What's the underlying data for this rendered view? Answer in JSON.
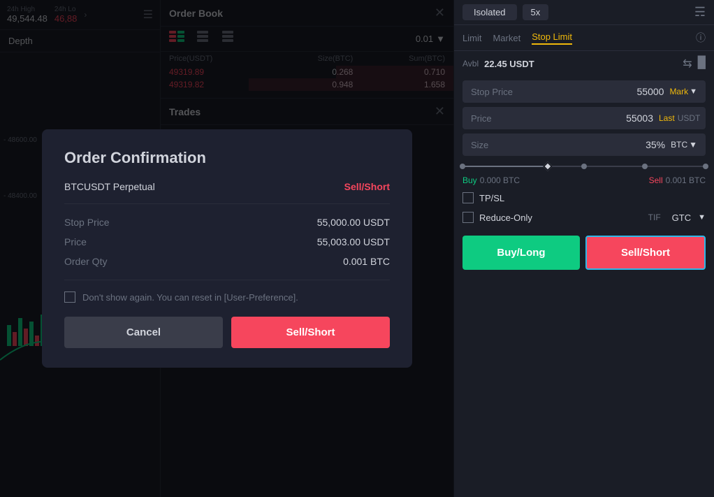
{
  "left_panel": {
    "stat_24h_high_label": "24h High",
    "stat_24h_low_label": "24h Lo",
    "stat_24h_high_value": "49,544.48",
    "stat_24h_low_value": "46,88",
    "depth_tab": "Depth",
    "price_label_1": "- 48600.00",
    "price_label_2": "- 48400.00"
  },
  "order_book": {
    "title": "Order Book",
    "decimal_value": "0.01",
    "col_price": "Price(USDT)",
    "col_size": "Size(BTC)",
    "col_sum": "Sum(BTC)",
    "sell_rows": [
      {
        "price": "49319.89",
        "size": "0.268",
        "sum": "0.710",
        "bar_pct": "40"
      },
      {
        "price": "49319.82",
        "size": "0.948",
        "sum": "1.658",
        "bar_pct": "70"
      }
    ],
    "trades_title": "Trades"
  },
  "right_panel": {
    "isolated_label": "Isolated",
    "leverage_label": "5x",
    "order_types": {
      "limit": "Limit",
      "market": "Market",
      "stop_limit": "Stop Limit",
      "active": "Stop Limit"
    },
    "avbl_label": "Avbl",
    "avbl_value": "22.45 USDT",
    "stop_price_label": "Stop Price",
    "stop_price_value": "55000",
    "stop_price_tag": "Mark",
    "price_label": "Price",
    "price_value": "55003",
    "price_tag": "Last",
    "price_unit": "USDT",
    "size_label": "Size",
    "size_value": "35%",
    "size_unit": "BTC",
    "buy_label": "Buy",
    "buy_amount": "0.000 BTC",
    "sell_label": "Sell",
    "sell_amount": "0.001 BTC",
    "tp_sl_label": "TP/SL",
    "reduce_only_label": "Reduce-Only",
    "tif_label": "TIF",
    "tif_value": "GTC",
    "buy_btn": "Buy/Long",
    "sell_btn": "Sell/Short"
  },
  "modal": {
    "title": "Order Confirmation",
    "pair": "BTCUSDT Perpetual",
    "side": "Sell/Short",
    "stop_price_label": "Stop Price",
    "stop_price_value": "55,000.00 USDT",
    "price_label": "Price",
    "price_value": "55,003.00 USDT",
    "order_qty_label": "Order Qty",
    "order_qty_value": "0.001 BTC",
    "checkbox_label": "Don't show again. You can reset in [User-Preference].",
    "cancel_btn": "Cancel",
    "confirm_btn": "Sell/Short"
  }
}
